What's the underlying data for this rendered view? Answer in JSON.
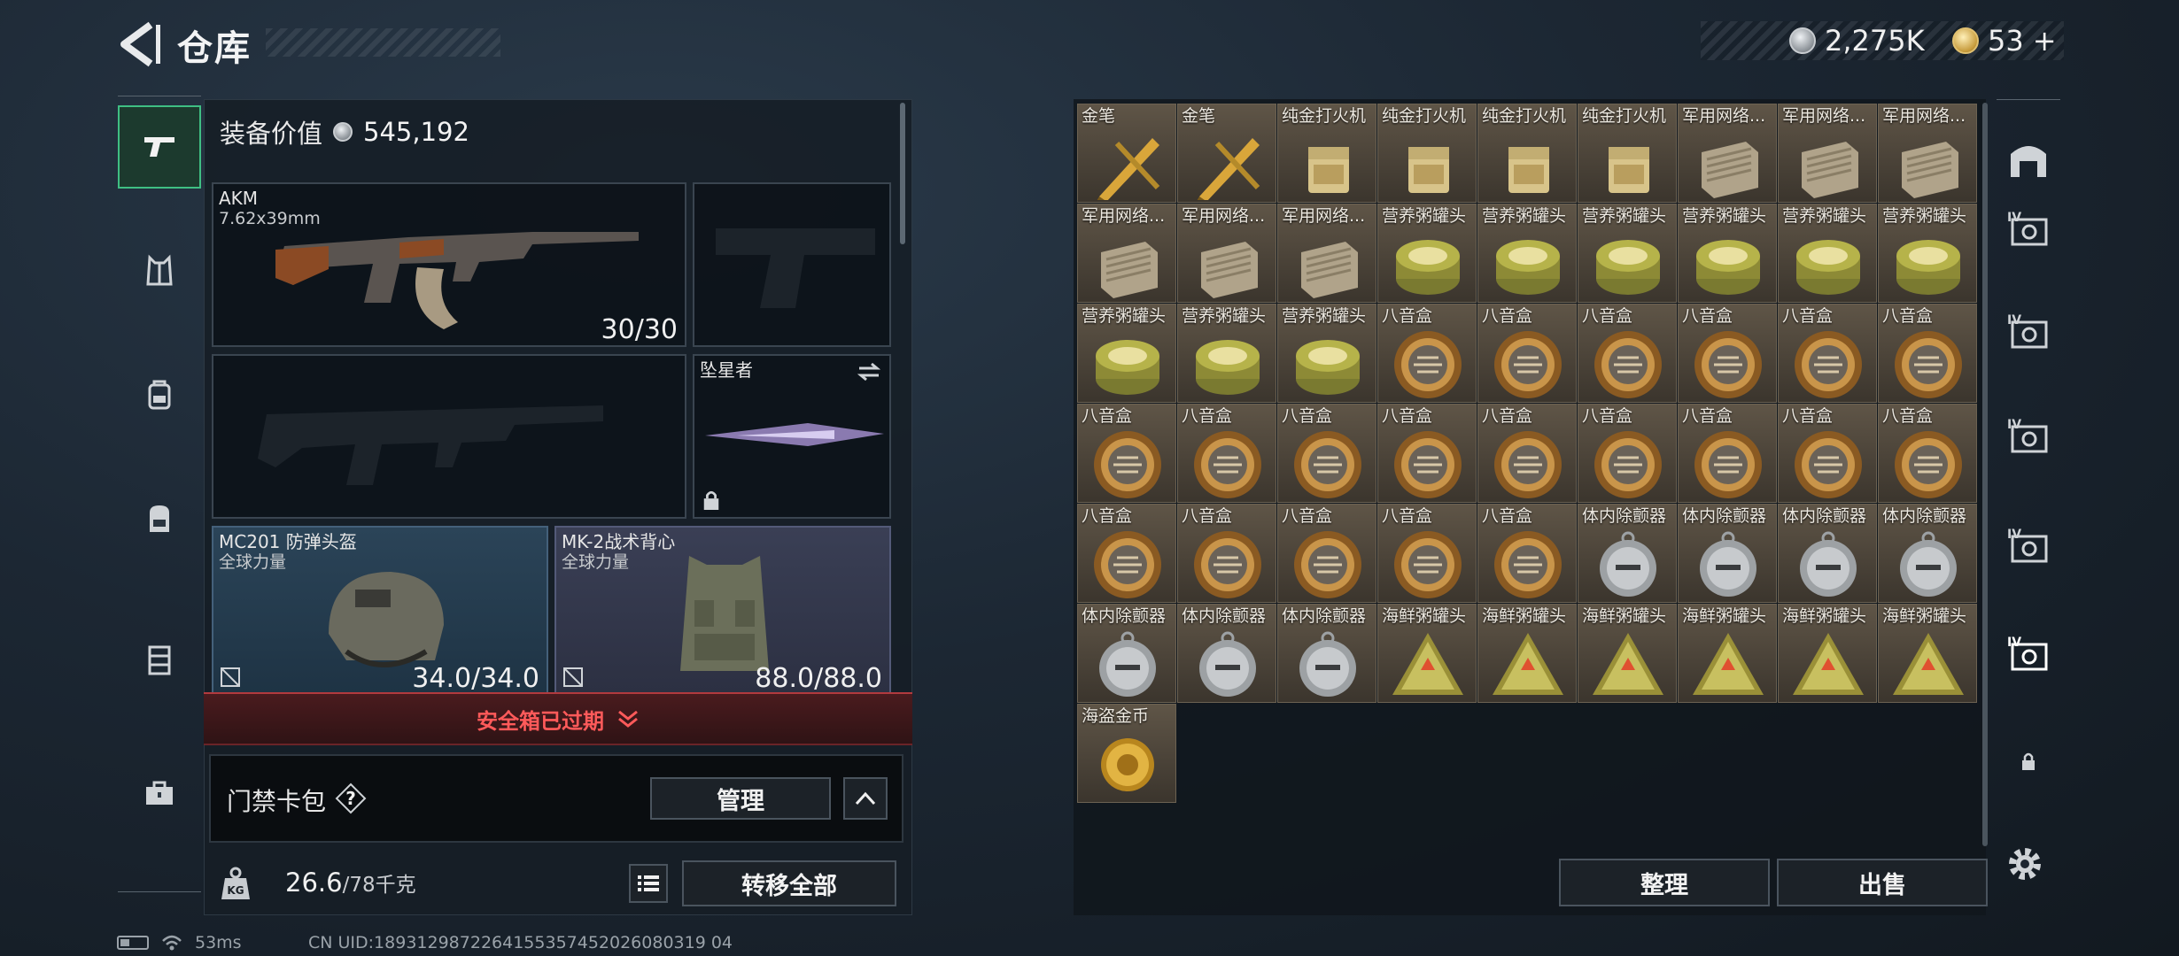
{
  "header": {
    "title": "仓库",
    "currency_silver": "2,275K",
    "currency_gold": "53",
    "gold_plus": "+"
  },
  "equipment": {
    "value_label": "装备价值",
    "value": "545,192",
    "primary_weapon": {
      "name": "AKM",
      "caliber": "7.62x39mm",
      "ammo": "30/30"
    },
    "melee": {
      "name": "坠星者"
    },
    "helmet": {
      "name": "MC201 防弹头盔",
      "faction": "全球力量",
      "durability": "34.0/34.0"
    },
    "vest": {
      "name": "MK-2战术背心",
      "faction": "全球力量",
      "durability": "88.0/88.0"
    },
    "safe_box_expired": "安全箱已过期",
    "keycard_label": "门禁卡包",
    "help_symbol": "?",
    "manage_button": "管理",
    "weight_current": "26.6",
    "weight_max": "/78千克",
    "transfer_all_button": "转移全部"
  },
  "storage": {
    "items": [
      {
        "name": "金笔",
        "icon": "gold-pen"
      },
      {
        "name": "金笔",
        "icon": "gold-pen"
      },
      {
        "name": "纯金打火机",
        "icon": "gold-lighter"
      },
      {
        "name": "纯金打火机",
        "icon": "gold-lighter"
      },
      {
        "name": "纯金打火机",
        "icon": "gold-lighter"
      },
      {
        "name": "纯金打火机",
        "icon": "gold-lighter"
      },
      {
        "name": "军用网络...",
        "icon": "network-device"
      },
      {
        "name": "军用网络...",
        "icon": "network-device"
      },
      {
        "name": "军用网络...",
        "icon": "network-device"
      },
      {
        "name": "军用网络...",
        "icon": "network-device"
      },
      {
        "name": "军用网络...",
        "icon": "network-device"
      },
      {
        "name": "军用网络...",
        "icon": "network-device"
      },
      {
        "name": "营养粥罐头",
        "icon": "tin-can"
      },
      {
        "name": "营养粥罐头",
        "icon": "tin-can"
      },
      {
        "name": "营养粥罐头",
        "icon": "tin-can"
      },
      {
        "name": "营养粥罐头",
        "icon": "tin-can"
      },
      {
        "name": "营养粥罐头",
        "icon": "tin-can"
      },
      {
        "name": "营养粥罐头",
        "icon": "tin-can"
      },
      {
        "name": "营养粥罐头",
        "icon": "tin-can"
      },
      {
        "name": "营养粥罐头",
        "icon": "tin-can"
      },
      {
        "name": "营养粥罐头",
        "icon": "tin-can"
      },
      {
        "name": "八音盒",
        "icon": "music-box"
      },
      {
        "name": "八音盒",
        "icon": "music-box"
      },
      {
        "name": "八音盒",
        "icon": "music-box"
      },
      {
        "name": "八音盒",
        "icon": "music-box"
      },
      {
        "name": "八音盒",
        "icon": "music-box"
      },
      {
        "name": "八音盒",
        "icon": "music-box"
      },
      {
        "name": "八音盒",
        "icon": "music-box"
      },
      {
        "name": "八音盒",
        "icon": "music-box"
      },
      {
        "name": "八音盒",
        "icon": "music-box"
      },
      {
        "name": "八音盒",
        "icon": "music-box"
      },
      {
        "name": "八音盒",
        "icon": "music-box"
      },
      {
        "name": "八音盒",
        "icon": "music-box"
      },
      {
        "name": "八音盒",
        "icon": "music-box"
      },
      {
        "name": "八音盒",
        "icon": "music-box"
      },
      {
        "name": "八音盒",
        "icon": "music-box"
      },
      {
        "name": "八音盒",
        "icon": "music-box"
      },
      {
        "name": "八音盒",
        "icon": "music-box"
      },
      {
        "name": "八音盒",
        "icon": "music-box"
      },
      {
        "name": "八音盒",
        "icon": "music-box"
      },
      {
        "name": "八音盒",
        "icon": "music-box"
      },
      {
        "name": "体内除颤器",
        "icon": "defibrillator"
      },
      {
        "name": "体内除颤器",
        "icon": "defibrillator"
      },
      {
        "name": "体内除颤器",
        "icon": "defibrillator"
      },
      {
        "name": "体内除颤器",
        "icon": "defibrillator"
      },
      {
        "name": "体内除颤器",
        "icon": "defibrillator"
      },
      {
        "name": "体内除颤器",
        "icon": "defibrillator"
      },
      {
        "name": "体内除颤器",
        "icon": "defibrillator"
      },
      {
        "name": "海鲜粥罐头",
        "icon": "seafood-can"
      },
      {
        "name": "海鲜粥罐头",
        "icon": "seafood-can"
      },
      {
        "name": "海鲜粥罐头",
        "icon": "seafood-can"
      },
      {
        "name": "海鲜粥罐头",
        "icon": "seafood-can"
      },
      {
        "name": "海鲜粥罐头",
        "icon": "seafood-can"
      },
      {
        "name": "海鲜粥罐头",
        "icon": "seafood-can"
      },
      {
        "name": "海盗金币",
        "icon": "pirate-coin"
      }
    ],
    "sort_button": "整理",
    "sell_button": "出售"
  },
  "status_bar": {
    "ping": "53ms",
    "uid": "CN UID:1893129872264155357452026080319 04"
  }
}
